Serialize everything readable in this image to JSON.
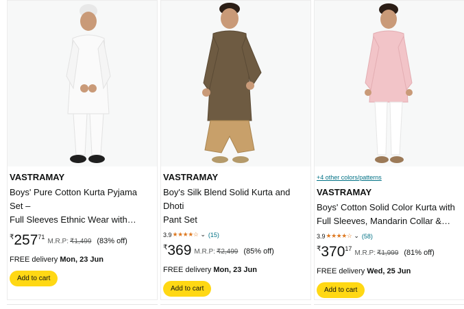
{
  "products": [
    {
      "brand": "VASTRAMAY",
      "title_line1": "Boys' Pure Cotton Kurta Pyjama Set –",
      "title_line2": "Full Sleeves Ethnic Wear with…",
      "currency": "₹",
      "price_whole": "257",
      "price_fraction": "71",
      "mrp_label": "M.R.P:",
      "mrp_value": "₹1,499",
      "discount": "(83% off)",
      "delivery_prefix": "FREE delivery",
      "delivery_date": "Mon, 23 Jun",
      "cart_label": "Add to cart"
    },
    {
      "brand": "VASTRAMAY",
      "title_line1": "Boy's Silk Blend Solid Kurta and Dhoti",
      "title_line2": "Pant Set",
      "rating": "3.9",
      "rating_stars": 3.9,
      "review_count": "(15)",
      "currency": "₹",
      "price_whole": "369",
      "price_fraction": "",
      "mrp_label": "M.R.P:",
      "mrp_value": "₹2,499",
      "discount": "(85% off)",
      "delivery_prefix": "FREE delivery",
      "delivery_date": "Mon, 23 Jun",
      "cart_label": "Add to cart"
    },
    {
      "color_options": "+4 other colors/patterns",
      "brand": "VASTRAMAY",
      "title_line1": "Boys' Cotton Solid Color Kurta with",
      "title_line2": "Full Sleeves, Mandarin Collar &…",
      "rating": "3.9",
      "rating_stars": 3.9,
      "review_count": "(58)",
      "currency": "₹",
      "price_whole": "370",
      "price_fraction": "17",
      "mrp_label": "M.R.P:",
      "mrp_value": "₹1,999",
      "discount": "(81% off)",
      "delivery_prefix": "FREE delivery",
      "delivery_date": "Wed, 25 Jun",
      "cart_label": "Add to cart"
    }
  ],
  "colors": {
    "star": "#de7921",
    "link": "#007185",
    "cart_button": "#ffd814"
  },
  "icons": [
    "chevron-down-icon",
    "star-icon"
  ]
}
